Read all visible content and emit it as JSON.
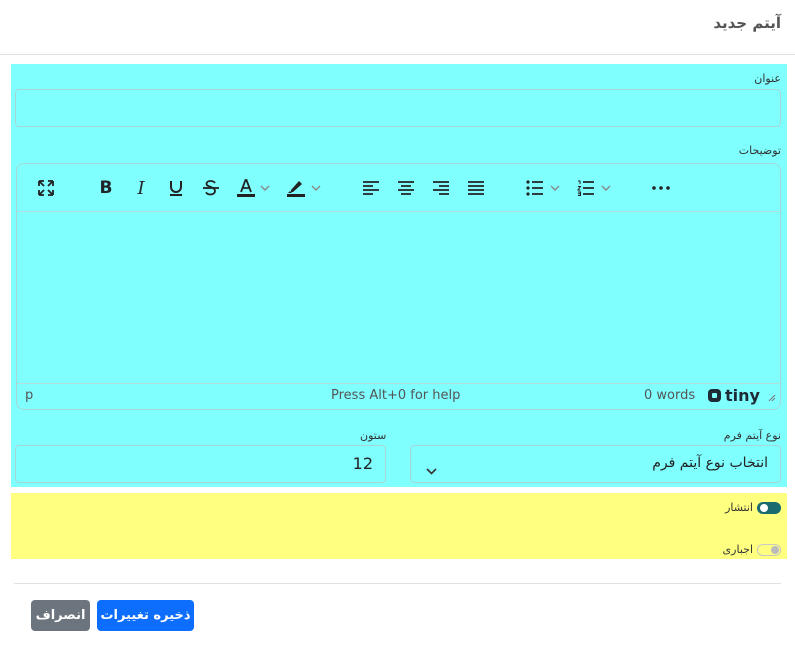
{
  "modal": {
    "title": "آیتم جدید"
  },
  "fields": {
    "title_label": "عنوان",
    "title_value": "",
    "description_label": "توضیحات",
    "column_label": "ستون",
    "column_value": "12",
    "item_type_label": "نوع آیتم فرم",
    "item_type_selected": "انتخاب نوع آیتم فرم"
  },
  "editor": {
    "toolbar_icons": [
      "fullscreen-icon",
      "bold-icon",
      "italic-icon",
      "underline-icon",
      "strikethrough-icon",
      "text-color-icon",
      "highlight-icon",
      "align-left-icon",
      "align-center-icon",
      "align-right-icon",
      "justify-icon",
      "bullet-list-icon",
      "numbered-list-icon",
      "more-icon"
    ],
    "status_path": "p",
    "status_help": "Press Alt+0 for help",
    "status_words": "0 words",
    "brand": "tiny"
  },
  "toggles": {
    "publish_label": "انتشار",
    "publish_on": true,
    "required_label": "اجباری",
    "required_on": false
  },
  "footer": {
    "save_label": "ذخیره تغییرات",
    "cancel_label": "انصراف"
  },
  "colors": {
    "primary": "#0d6efd",
    "secondary": "#6c757d",
    "toggle_on": "#1a6b70",
    "highlight_cyan": "#80ffff",
    "highlight_yellow": "#ffff80"
  }
}
